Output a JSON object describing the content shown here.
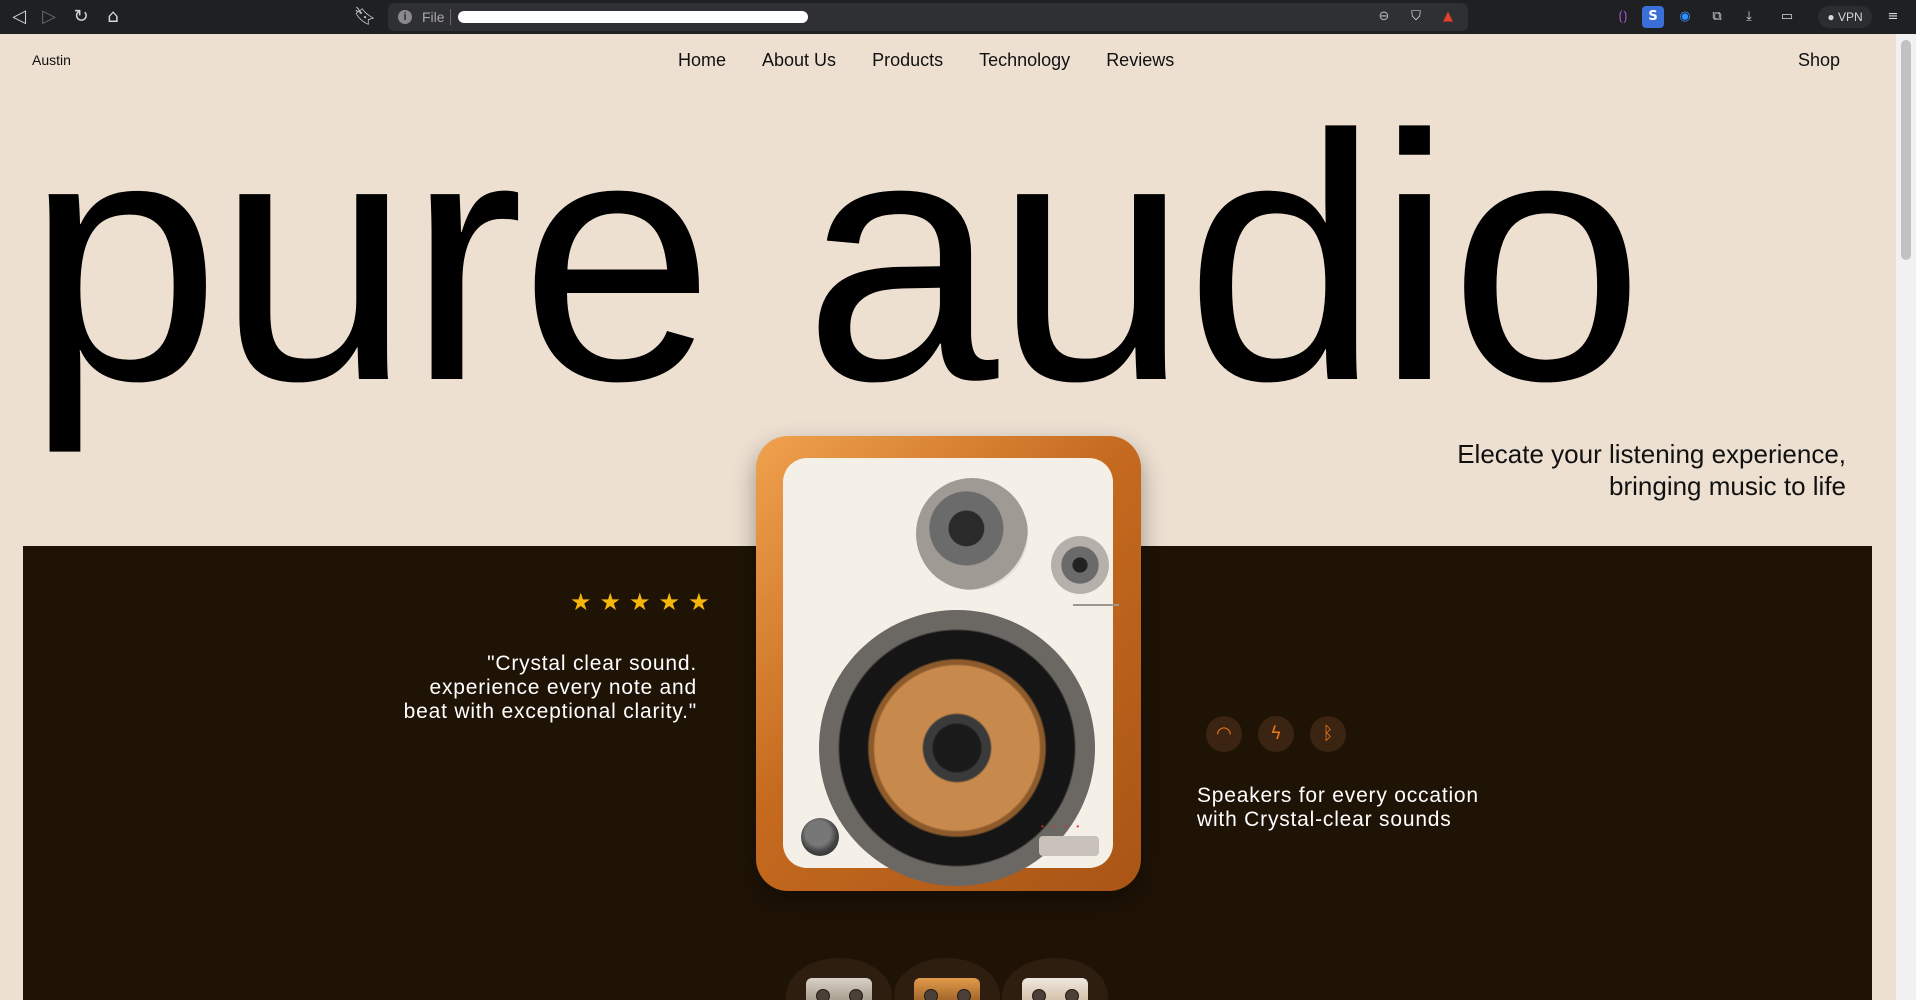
{
  "browser": {
    "file_label": "File",
    "vpn_label": "VPN"
  },
  "site": {
    "brand": "Austin",
    "nav": [
      "Home",
      "About Us",
      "Products",
      "Technology",
      "Reviews"
    ],
    "shop": "Shop"
  },
  "hero": {
    "title": "pure audio",
    "tagline_line1": "Elecate your listening experience,",
    "tagline_line2": "bringing music to life"
  },
  "review": {
    "rating": 5,
    "quote_line1": "\"Crystal clear sound.",
    "quote_line2": "experience every note and",
    "quote_line3": "beat with exceptional clarity.\""
  },
  "features": {
    "icons": [
      "wifi-icon",
      "lightning-icon",
      "bluetooth-icon"
    ],
    "copy_line1": "Speakers for every occation",
    "copy_line2": "with Crystal-clear sounds"
  },
  "colors": {
    "page_bg": "#ede0d1",
    "dark_section": "#1f1306",
    "star": "#f5b50a",
    "feature_accent": "#f07a18"
  }
}
